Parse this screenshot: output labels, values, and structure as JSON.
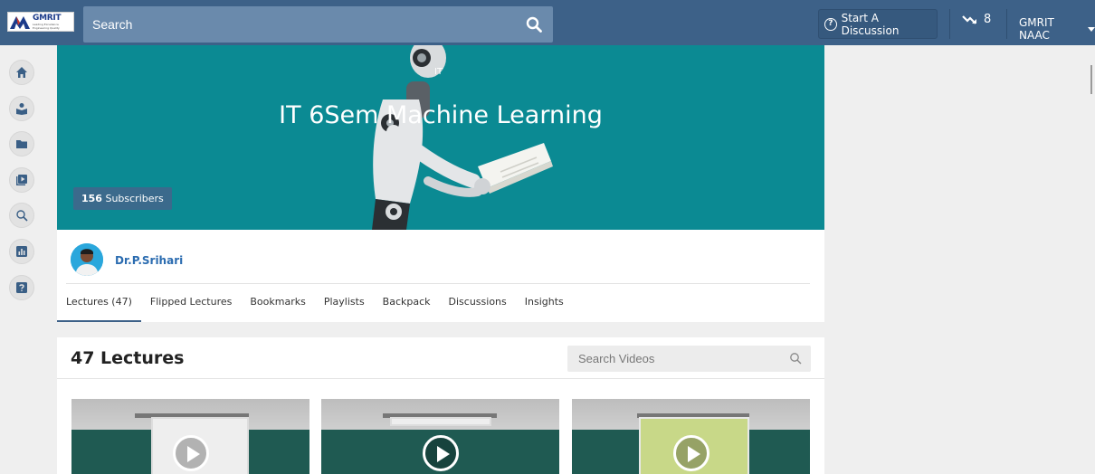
{
  "header": {
    "logo_text": "GMRIT",
    "logo_subtext": "Leading Excellence Engineering Quality",
    "search_placeholder": "Search",
    "start_discussion_label": "Start A Discussion",
    "trend_count": "8",
    "account_name": "GMRIT NAAC"
  },
  "sidebar": {
    "items": [
      {
        "icon": "home-icon"
      },
      {
        "icon": "person-book-icon"
      },
      {
        "icon": "folder-icon"
      },
      {
        "icon": "video-library-icon"
      },
      {
        "icon": "search-icon"
      },
      {
        "icon": "bar-chart-icon"
      },
      {
        "icon": "help-icon"
      }
    ]
  },
  "banner": {
    "tag": "IT",
    "title": "IT 6Sem Machine Learning",
    "subscribers_count": "156",
    "subscribers_label": "Subscribers",
    "bg_color": "#0b8a93"
  },
  "course": {
    "author": "Dr.P.Srihari",
    "tabs": [
      {
        "label": "Lectures (47)",
        "active": true
      },
      {
        "label": "Flipped Lectures",
        "active": false
      },
      {
        "label": "Bookmarks",
        "active": false
      },
      {
        "label": "Playlists",
        "active": false
      },
      {
        "label": "Backpack",
        "active": false
      },
      {
        "label": "Discussions",
        "active": false
      },
      {
        "label": "Insights",
        "active": false
      }
    ]
  },
  "lectures": {
    "title": "47 Lectures",
    "search_placeholder": "Search Videos",
    "videos": [
      {
        "name": "lecture-video-1"
      },
      {
        "name": "lecture-video-2"
      },
      {
        "name": "lecture-video-3"
      }
    ]
  },
  "colors": {
    "header_bg": "#3d6188",
    "link": "#2b6cb0"
  }
}
